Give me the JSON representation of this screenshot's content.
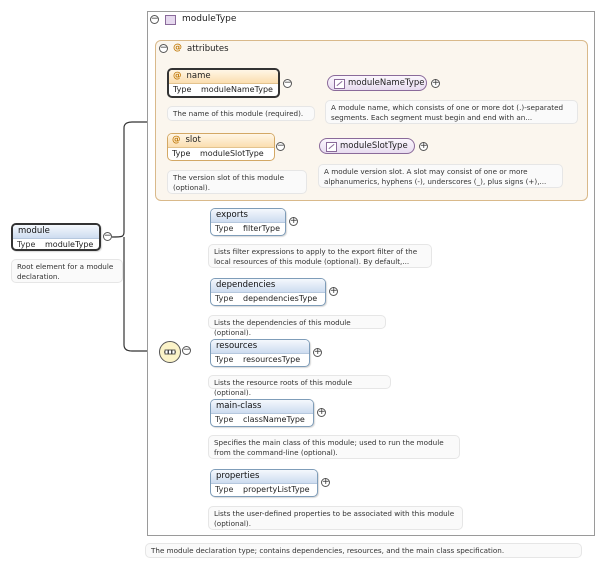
{
  "complex_type": {
    "name": "moduleType",
    "documentation": "The module declaration type; contains dependencies, resources, and the main class specification."
  },
  "attributes_group": {
    "label": "attributes",
    "items": [
      {
        "name": "name",
        "type_label": "Type",
        "type": "moduleNameType",
        "documentation": "The name of this module (required).",
        "simple_type": "moduleNameType",
        "simple_type_doc": "A module name, which consists of one or more dot (.)-separated segments. Each segment must begin and end with an..."
      },
      {
        "name": "slot",
        "type_label": "Type",
        "type": "moduleSlotType",
        "documentation": "The version slot of this module (optional).",
        "simple_type": "moduleSlotType",
        "simple_type_doc": "A module version slot. A slot may consist of one or more alphanumerics, hyphens (-), underscores (_), plus signs (+),..."
      }
    ]
  },
  "root_element": {
    "name": "module",
    "type_label": "Type",
    "type": "moduleType",
    "documentation": "Root element for a module declaration."
  },
  "elements": [
    {
      "name": "exports",
      "type_label": "Type",
      "type": "filterType",
      "documentation": "Lists filter expressions to apply to the export filter of the local resources of this module (optional). By default,..."
    },
    {
      "name": "dependencies",
      "type_label": "Type",
      "type": "dependenciesType",
      "documentation": "Lists the dependencies of this module (optional)."
    },
    {
      "name": "resources",
      "type_label": "Type",
      "type": "resourcesType",
      "documentation": "Lists the resource roots of this module (optional)."
    },
    {
      "name": "main-class",
      "type_label": "Type",
      "type": "classNameType",
      "documentation": "Specifies the main class of this module; used to run the module from the command-line (optional)."
    },
    {
      "name": "properties",
      "type_label": "Type",
      "type": "propertyListType",
      "documentation": "Lists the user-defined properties to be associated with this module (optional)."
    }
  ],
  "icons": {
    "collapse": "−",
    "expand": "+",
    "attribute": "@"
  }
}
